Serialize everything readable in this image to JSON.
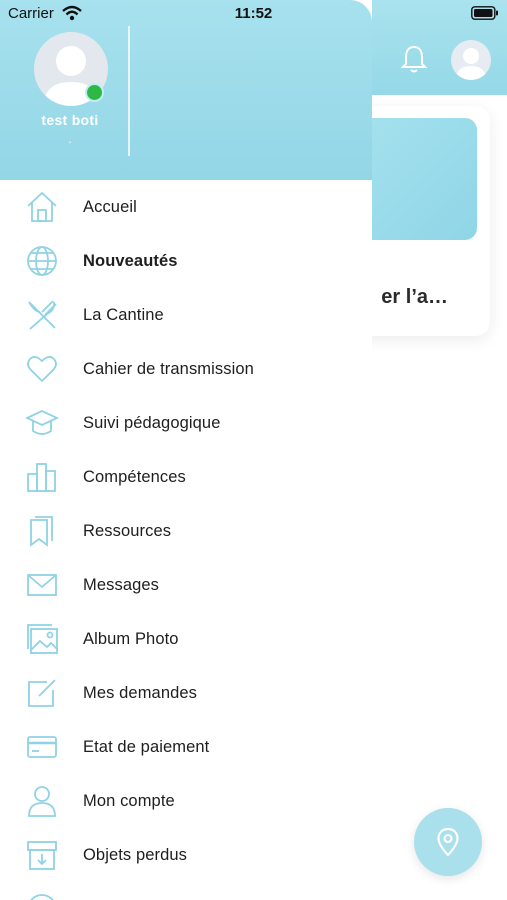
{
  "status_bar": {
    "carrier": "Carrier",
    "time": "11:52"
  },
  "profile": {
    "name": "test boti",
    "subtitle": "."
  },
  "background": {
    "card_title": "er l’a…"
  },
  "menu": {
    "items": [
      {
        "label": "Accueil",
        "icon": "home-icon",
        "bold": false
      },
      {
        "label": "Nouveautés",
        "icon": "globe-icon",
        "bold": true
      },
      {
        "label": "La Cantine",
        "icon": "cutlery-icon",
        "bold": false
      },
      {
        "label": "Cahier de transmission",
        "icon": "heart-icon",
        "bold": false
      },
      {
        "label": "Suivi pédagogique",
        "icon": "graduation-cap-icon",
        "bold": false
      },
      {
        "label": "Compétences",
        "icon": "bar-chart-icon",
        "bold": false
      },
      {
        "label": "Ressources",
        "icon": "bookmarks-icon",
        "bold": false
      },
      {
        "label": "Messages",
        "icon": "envelope-icon",
        "bold": false
      },
      {
        "label": "Album Photo",
        "icon": "photo-album-icon",
        "bold": false
      },
      {
        "label": "Mes demandes",
        "icon": "edit-icon",
        "bold": false
      },
      {
        "label": "Etat de paiement",
        "icon": "credit-card-icon",
        "bold": false
      },
      {
        "label": "Mon compte",
        "icon": "user-icon",
        "bold": false
      },
      {
        "label": "Objets perdus",
        "icon": "archive-box-icon",
        "bold": false
      }
    ]
  },
  "colors": {
    "accent": "#95d8e7",
    "icon_stroke": "#8fd3e4",
    "online": "#2fb845"
  }
}
